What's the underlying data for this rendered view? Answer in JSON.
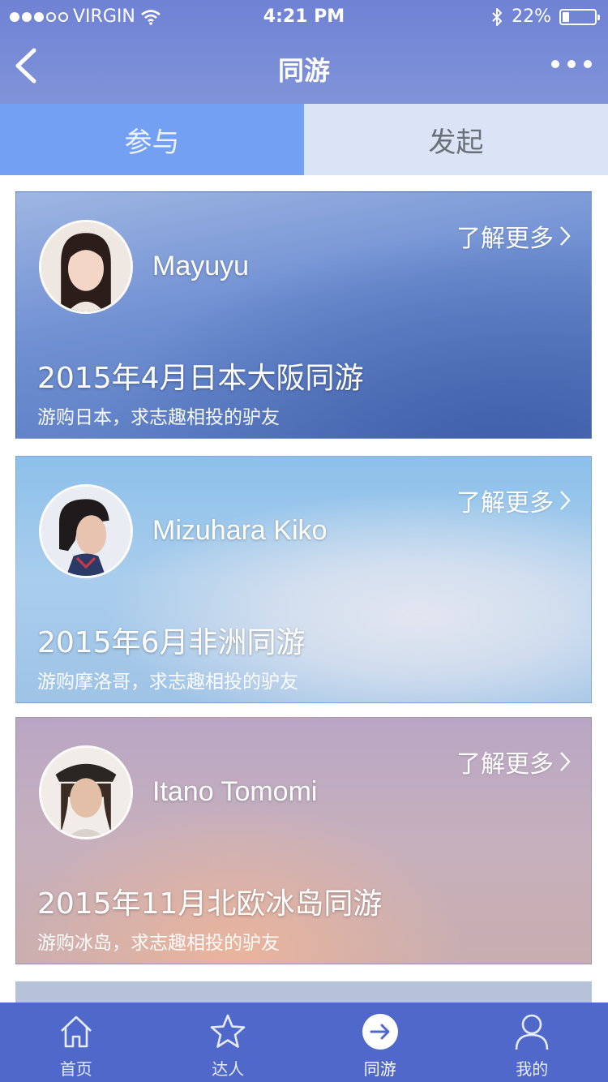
{
  "status_bar": {
    "carrier": "VIRGIN",
    "time": "4:21 PM",
    "battery": "22%",
    "battery_level": 0.22,
    "signal_full": 3,
    "signal_total": 5
  },
  "nav": {
    "title": "同游"
  },
  "tabs": [
    {
      "label": "参与",
      "active": true
    },
    {
      "label": "发起",
      "active": false
    }
  ],
  "cards": [
    {
      "name": "Mayuyu",
      "more": "了解更多",
      "title": "2015年4月日本大阪同游",
      "desc": "游购日本，求志趣相投的驴友"
    },
    {
      "name": "Mizuhara Kiko",
      "more": "了解更多",
      "title": "2015年6月非洲同游",
      "desc": "游购摩洛哥，求志趣相投的驴友"
    },
    {
      "name": "Itano Tomomi",
      "more": "了解更多",
      "title": "2015年11月北欧冰岛同游",
      "desc": "游购冰岛，求志趣相投的驴友"
    }
  ],
  "tabbar": [
    {
      "label": "首页",
      "icon": "home-icon",
      "active": false
    },
    {
      "label": "达人",
      "icon": "star-icon",
      "active": false
    },
    {
      "label": "同游",
      "icon": "arrow-right-circle-icon",
      "active": true
    },
    {
      "label": "我的",
      "icon": "person-icon",
      "active": false
    }
  ],
  "colors": {
    "header": "#7387d6",
    "tab_active": "#73a0f3",
    "tab_inactive": "#dbe4f6",
    "tabbar": "#4f68c9"
  }
}
